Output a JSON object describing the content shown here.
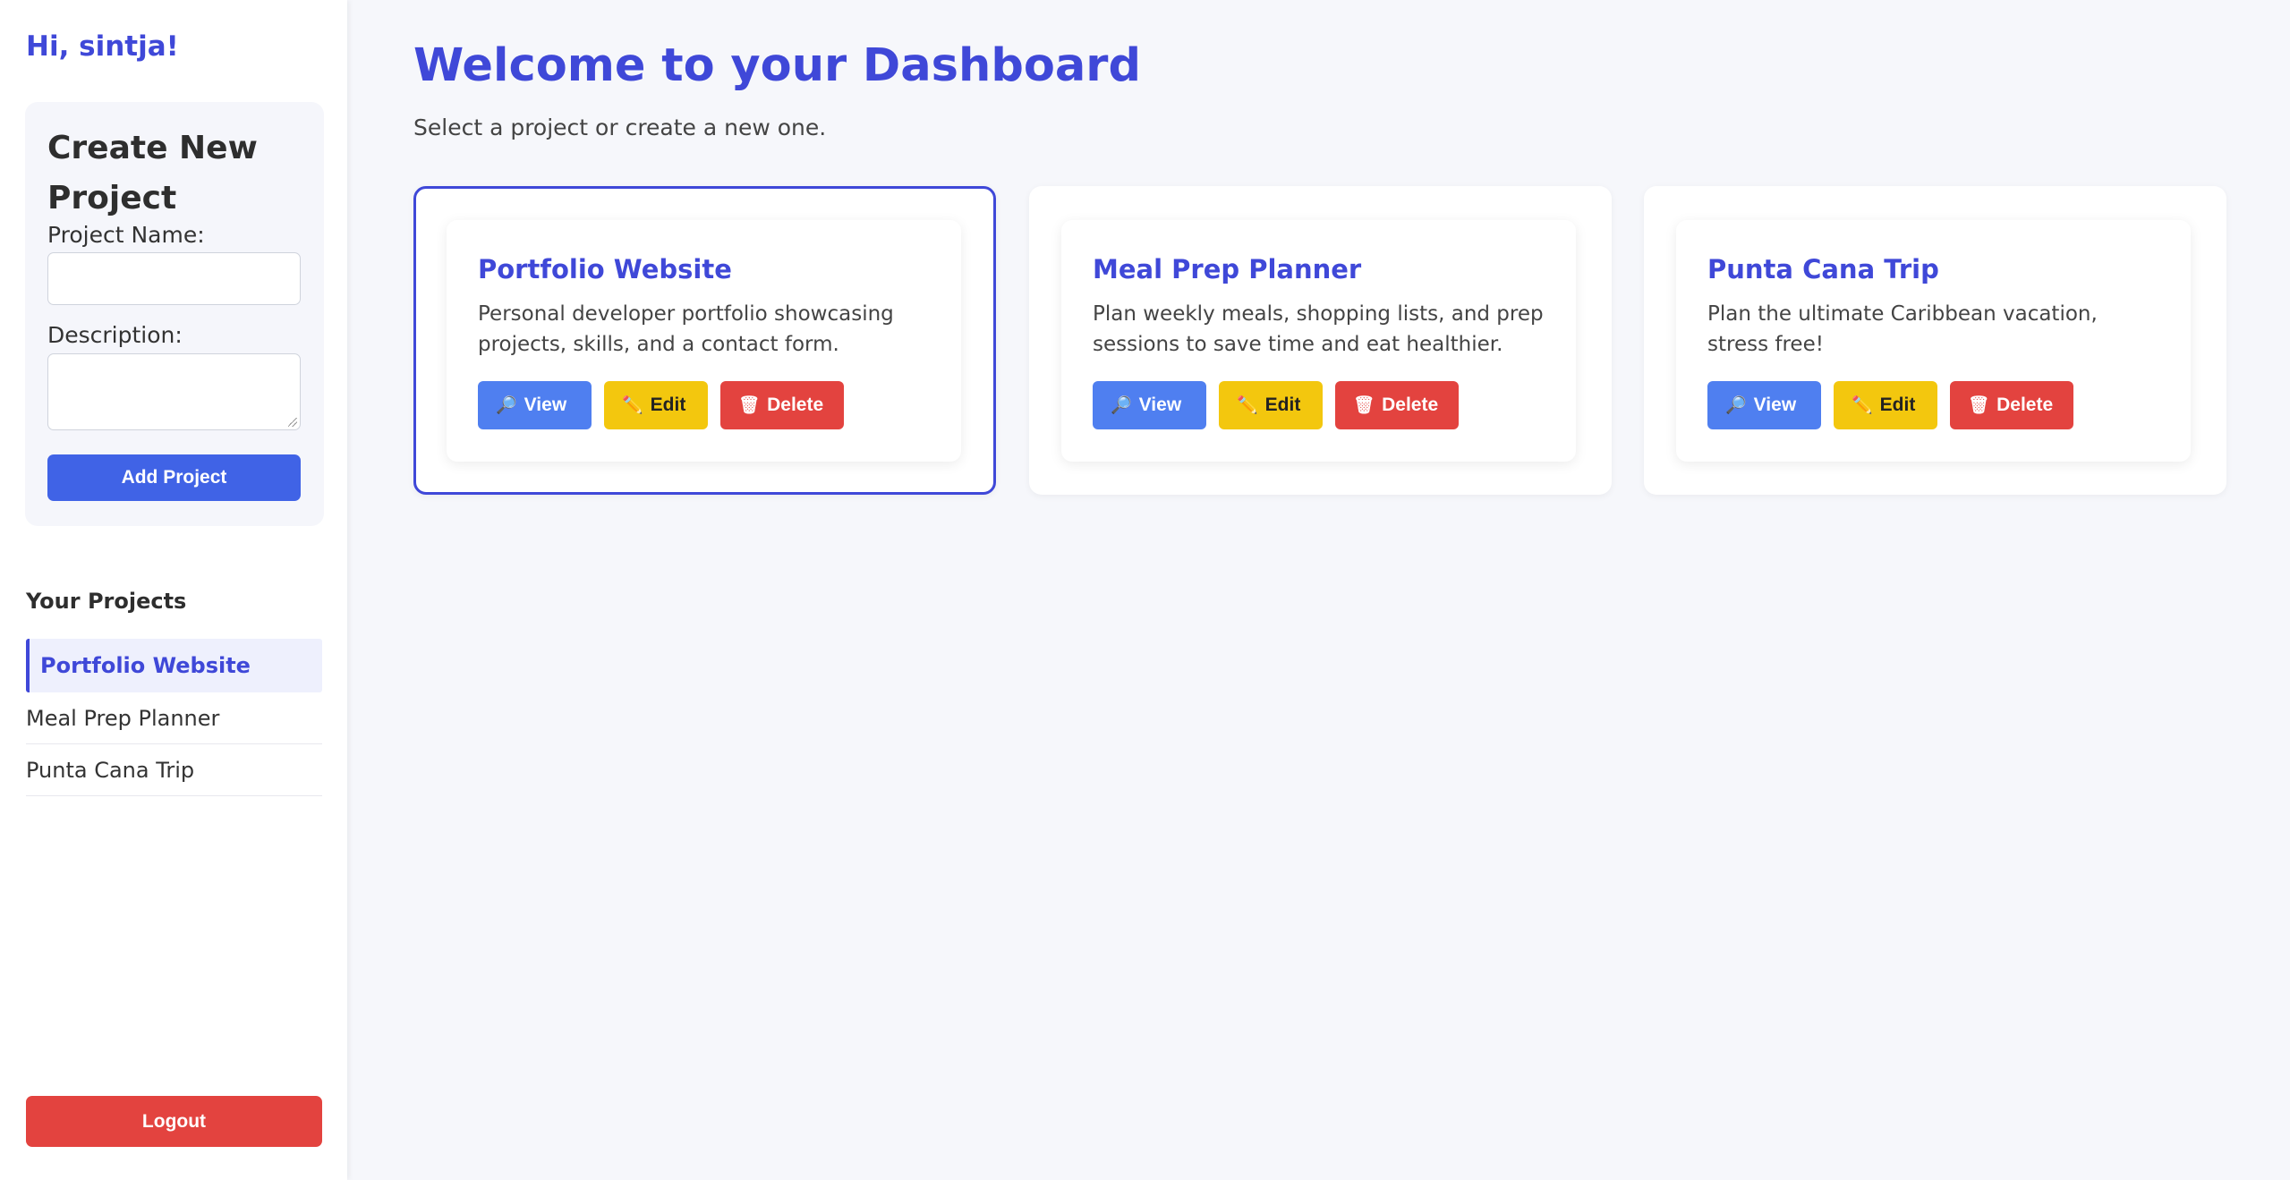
{
  "sidebar": {
    "greeting": "Hi, sintja!",
    "create_panel": {
      "title": "Create New Project",
      "name_label": "Project Name:",
      "name_value": "",
      "description_label": "Description:",
      "description_value": "",
      "add_button": "Add Project"
    },
    "projects_heading": "Your Projects",
    "projects": [
      {
        "label": "Portfolio Website",
        "active": true
      },
      {
        "label": "Meal Prep Planner",
        "active": false
      },
      {
        "label": "Punta Cana Trip",
        "active": false
      }
    ],
    "logout_button": "Logout"
  },
  "main": {
    "title": "Welcome to your Dashboard",
    "subtitle": "Select a project or create a new one.",
    "cards": [
      {
        "title": "Portfolio Website",
        "description": "Personal developer portfolio showcasing projects, skills, and a contact form.",
        "selected": true
      },
      {
        "title": "Meal Prep Planner",
        "description": "Plan weekly meals, shopping lists, and prep sessions to save time and eat healthier.",
        "selected": false
      },
      {
        "title": "Punta Cana Trip",
        "description": "Plan the ultimate Caribbean vacation, stress free!",
        "selected": false
      }
    ],
    "card_buttons": {
      "view": "View",
      "edit": "Edit",
      "delete": "Delete",
      "view_icon": "magnifier-icon",
      "edit_icon": "pencil-icon",
      "delete_icon": "trash-icon"
    }
  },
  "colors": {
    "accent": "#3f48d8",
    "primary_button": "#4063e6",
    "view_button": "#4f7ff0",
    "edit_button": "#f3c70e",
    "delete_button": "#e3433f",
    "background": "#f6f7fb"
  }
}
